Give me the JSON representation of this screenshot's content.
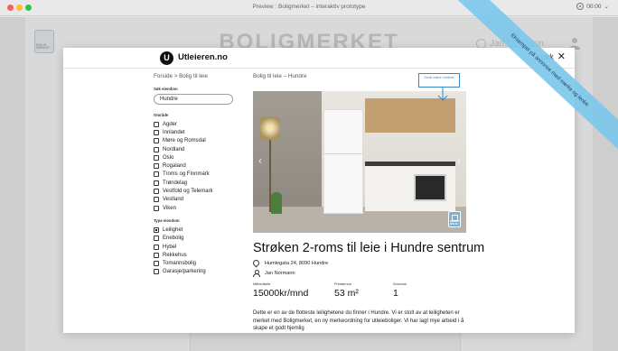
{
  "window": {
    "title": "Preview : Boligmerket – interaktiv prototype",
    "timer": "00:00"
  },
  "background": {
    "brand": "BOLIGMERKET",
    "logo_text": "BOLIG MERKET",
    "user_name": "Jan Normann"
  },
  "modal": {
    "logo_letter": "U",
    "site_name": "Utleieren.no",
    "close_label": "Lukk"
  },
  "sidebar": {
    "breadcrumb": "Forside > Bolig til leie",
    "search_label": "Søk eiendom",
    "search_value": "Hundre",
    "area_label": "Område",
    "areas": [
      {
        "label": "Agder",
        "checked": false
      },
      {
        "label": "Innlandet",
        "checked": false
      },
      {
        "label": "Møre og Romsdal",
        "checked": false
      },
      {
        "label": "Nordland",
        "checked": false
      },
      {
        "label": "Oslo",
        "checked": false
      },
      {
        "label": "Rogaland",
        "checked": false
      },
      {
        "label": "Troms og Finnmark",
        "checked": false
      },
      {
        "label": "Trøndelag",
        "checked": false
      },
      {
        "label": "Vestfold og Telemark",
        "checked": false
      },
      {
        "label": "Vestland",
        "checked": false
      },
      {
        "label": "Viken",
        "checked": false
      }
    ],
    "type_label": "Type eiendom",
    "types": [
      {
        "label": "Leilighet",
        "checked": true
      },
      {
        "label": "Enebolig",
        "checked": false
      },
      {
        "label": "Hybel",
        "checked": false
      },
      {
        "label": "Rekkehus",
        "checked": false
      },
      {
        "label": "Tomannsbolig",
        "checked": false
      },
      {
        "label": "Garasje/parkering",
        "checked": false
      }
    ]
  },
  "listing": {
    "breadcrumb": "Bolig til leie – Hundre",
    "title": "Strøken 2-roms til leie i Hundre sentrum",
    "address": "Humlegata 24, 8090 Hundre",
    "owner": "Jan Normann",
    "facts": [
      {
        "label": "Månedsleie",
        "value": "15000kr/mnd"
      },
      {
        "label": "Primærrom",
        "value": "53 m²"
      },
      {
        "label": "Soverom",
        "value": "1"
      }
    ],
    "description": "Dette er en av de flotteste leilighetene du finner i Hundre. Vi er stolt av at leiligheten er merket med Boligmerket, en ny merkeordning for utleieboliger. Vi har lagt mye arbeid i å skape et godt hjemlig",
    "gallery_badge": "MERKET BOLIG"
  },
  "annotation": {
    "box_text": "Scroll videre i bildene",
    "banner_text": "Eksempel på annonse med merke og lenke"
  },
  "colors": {
    "accent_blue": "#3a87c8",
    "banner": "#7dc8eb",
    "badge": "#7ab1d4"
  }
}
